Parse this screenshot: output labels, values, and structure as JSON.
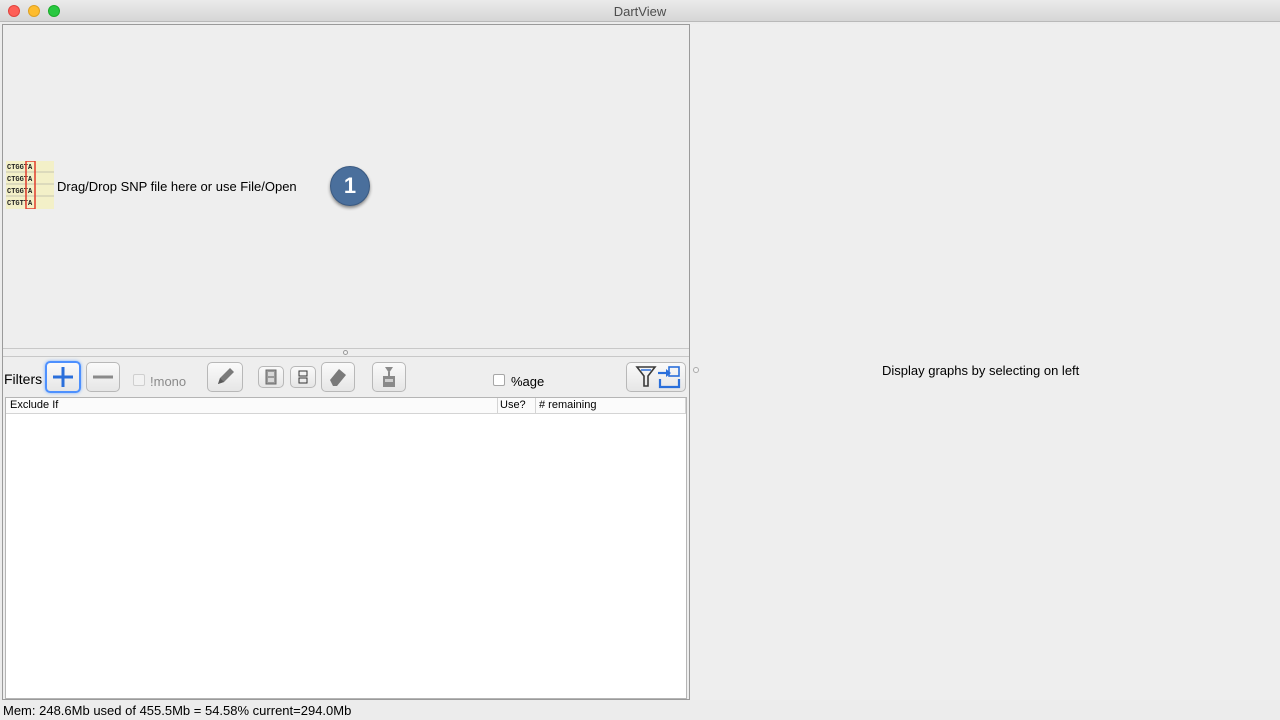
{
  "window": {
    "title": "DartView"
  },
  "top_panel": {
    "drop_hint": "Drag/Drop SNP file here or use File/Open",
    "step_badge": "1",
    "snp_icon": "snp-grid-icon"
  },
  "toolbar": {
    "filters_label": "Filters",
    "add_icon": "plus-icon",
    "remove_icon": "minus-icon",
    "mono_label": "!mono",
    "mono_checked": false,
    "edit_icon": "pencil-icon",
    "percentage_label": "%age",
    "percentage_checked": false,
    "apply_icon": "filter-export-icon"
  },
  "table": {
    "columns": [
      "Exclude If",
      "Use?",
      "# remaining"
    ],
    "rows": []
  },
  "right_panel": {
    "message": "Display graphs by selecting on left"
  },
  "status": {
    "memory_text": "Mem: 248.6Mb used of 455.5Mb = 54.58% current=294.0Mb"
  },
  "colors": {
    "accent": "#2a6fdb",
    "badge": "#4a6f9c"
  }
}
